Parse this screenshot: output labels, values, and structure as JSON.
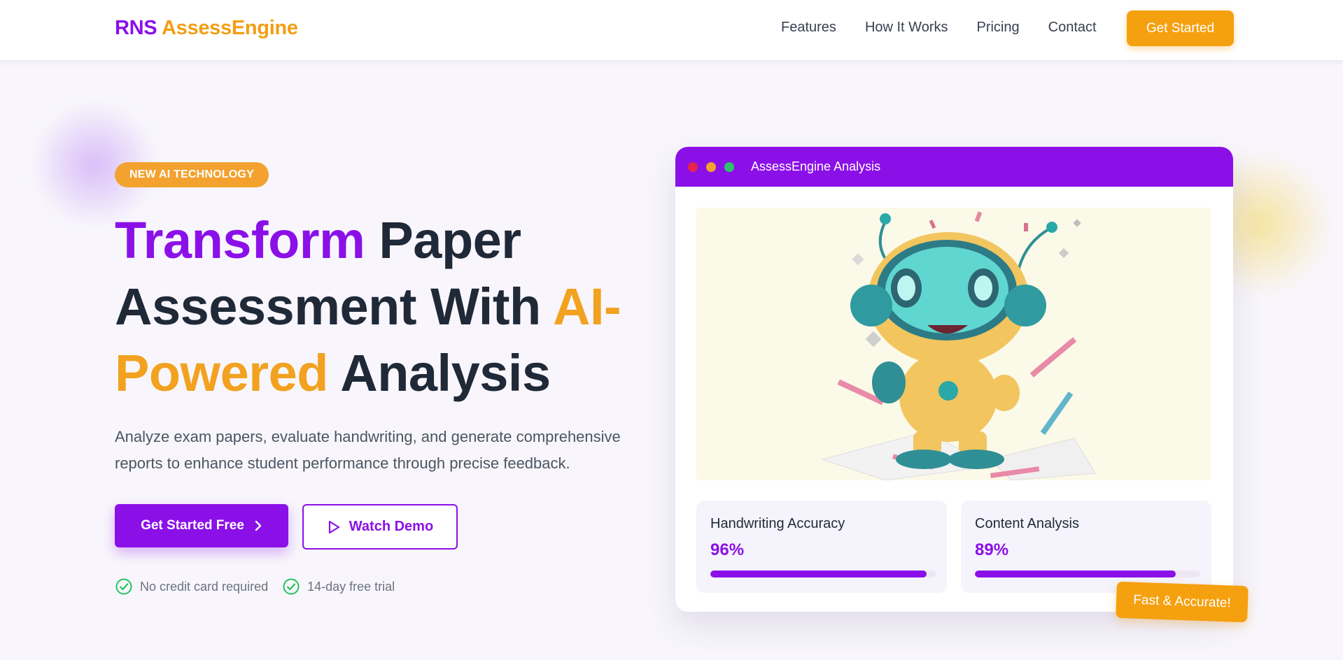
{
  "brand": {
    "part1": "RNS",
    "part2": "AssessEngine"
  },
  "nav": {
    "links": [
      "Features",
      "How It Works",
      "Pricing",
      "Contact"
    ],
    "cta": "Get Started"
  },
  "hero": {
    "badge": "NEW AI TECHNOLOGY",
    "headline": {
      "w1": "Transform",
      "w2": " Paper Assessment With ",
      "w3": "AI-Powered",
      "w4": " Analysis"
    },
    "subtext": "Analyze exam papers, evaluate handwriting, and generate comprehensive reports to enhance student performance through precise feedback.",
    "primary_cta": "Get Started Free",
    "secondary_cta": "Watch Demo",
    "checks": [
      "No credit card required",
      "14-day free trial"
    ]
  },
  "analysis_card": {
    "title": "AssessEngine Analysis",
    "window_dots": [
      "#e5244b",
      "#f3a22f",
      "#2fc26b"
    ],
    "illustration_icon": "robot-mascot-icon",
    "stats": [
      {
        "label": "Handwriting Accuracy",
        "value": "96%",
        "fill": 0.96
      },
      {
        "label": "Content Analysis",
        "value": "89%",
        "fill": 0.89
      }
    ],
    "float_badge": "Fast & Accurate!"
  },
  "colors": {
    "purple": "#8b10e8",
    "orange": "#f5a00f",
    "dark": "#1f2937"
  }
}
